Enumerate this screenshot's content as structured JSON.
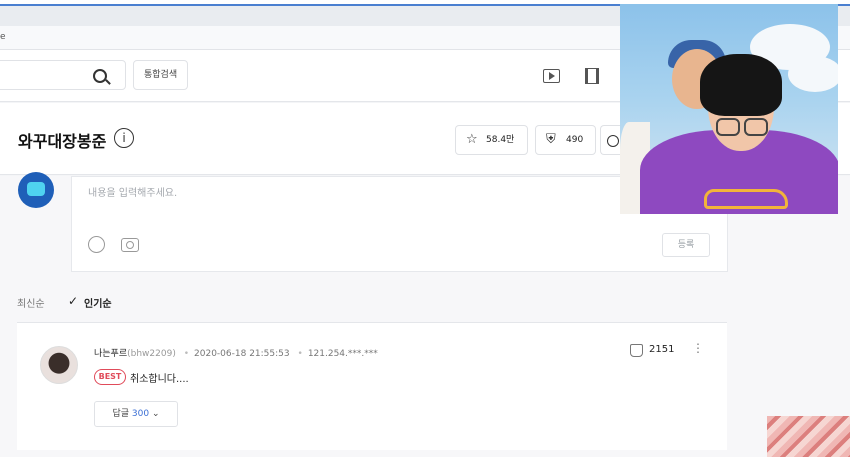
{
  "browser": {
    "mark": "e"
  },
  "header": {
    "integrated_search_label": "통합검색"
  },
  "channel": {
    "title": "와꾸대장봉준",
    "info_glyph": "i",
    "stats": [
      {
        "icon": "star-icon",
        "glyph": "☆",
        "value": "58.4만"
      },
      {
        "icon": "shield-icon",
        "glyph": "⛨",
        "value": "490"
      }
    ]
  },
  "editor": {
    "placeholder": "내용을 입력해주세요.",
    "submit_label": "등록"
  },
  "sort": {
    "recent_label": "최신순",
    "popular_label": "인기순",
    "check_glyph": "✓"
  },
  "comment": {
    "nickname": "나는푸르",
    "user_id": "(bhw2209)",
    "datetime": "2020-06-18 21:55:53",
    "ip": "121.254.***.***",
    "separator": "•",
    "badge": "BEST",
    "text": "취소합니다....",
    "likes": "2151",
    "more_glyph": "⋮",
    "reply_label": "답글",
    "reply_count": "300",
    "reply_chevron": "⌄"
  },
  "colors": {
    "accent_blue": "#3b6fd4",
    "best_red": "#e04b5a",
    "webcam_shirt": "#8e49c0"
  }
}
